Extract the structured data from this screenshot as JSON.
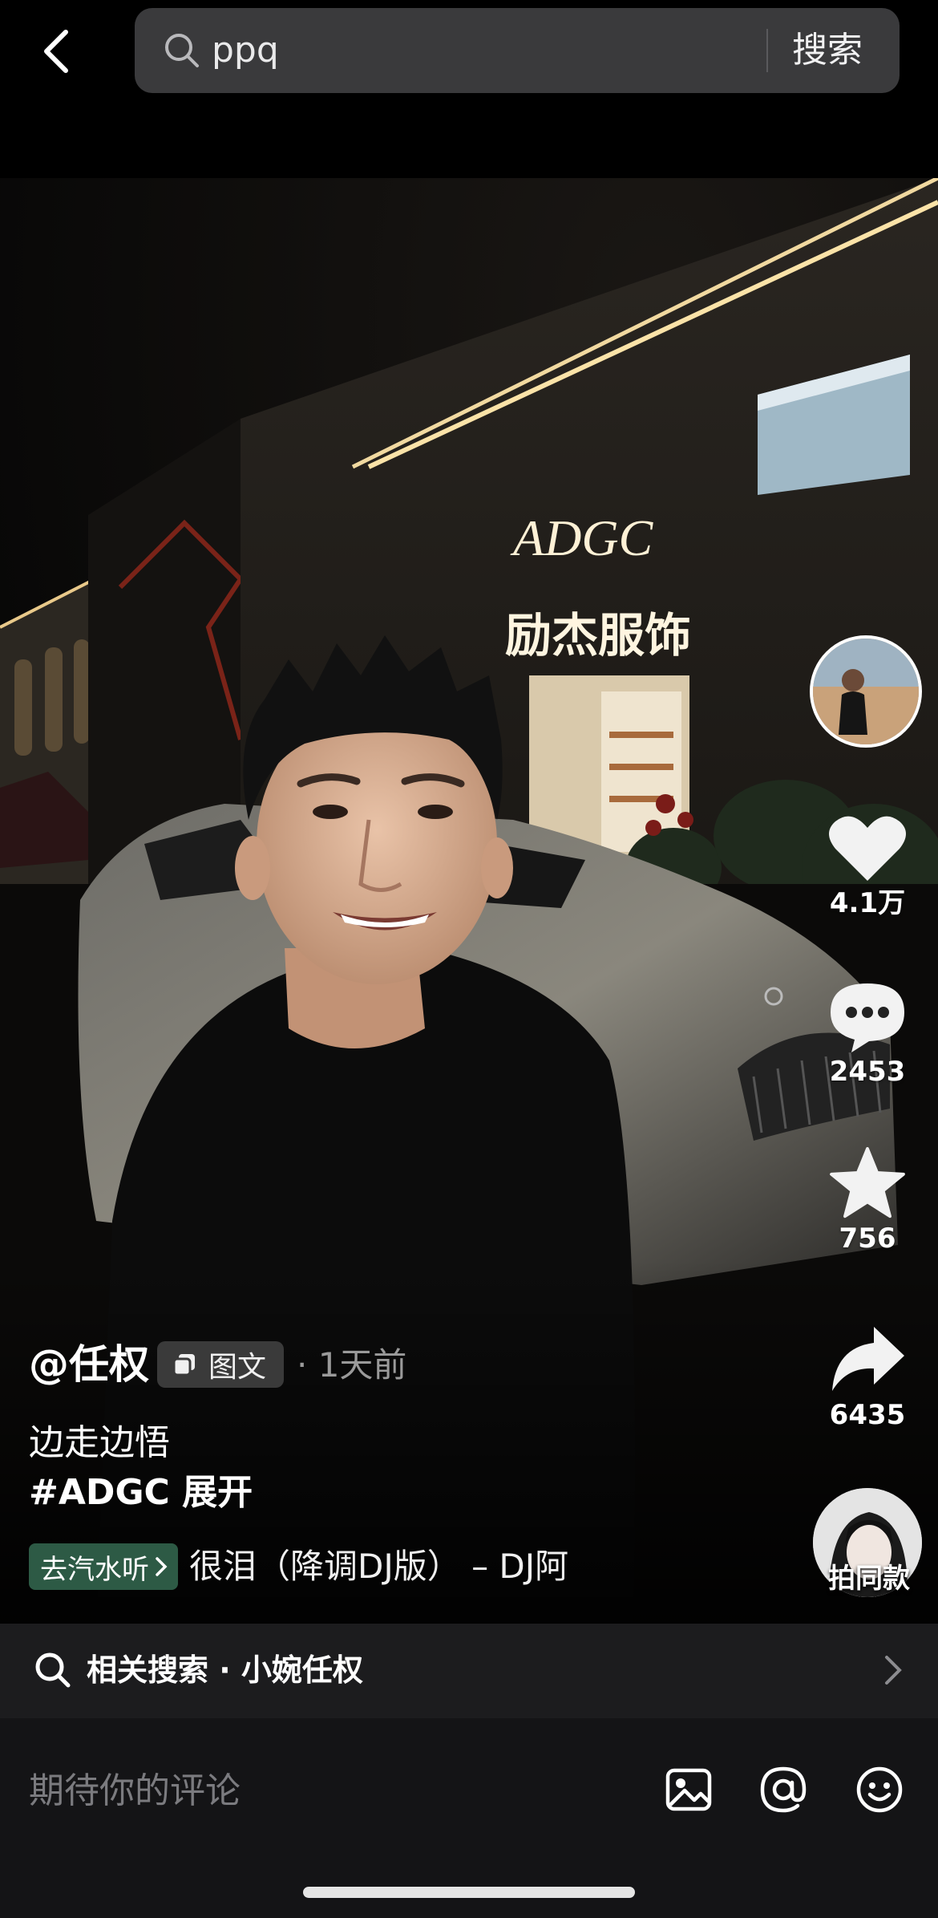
{
  "search": {
    "query": "ppq",
    "button": "搜索"
  },
  "post": {
    "author": "@任权",
    "type_label": "图文",
    "time": "· 1天前",
    "description": "边走边悟",
    "hashtags": "#ADGC  展开",
    "music_button": "去汽水听",
    "music_title": "很泪（降调DJ版） – DJ阿"
  },
  "stats": {
    "likes": "4.1万",
    "comments": "2453",
    "favorites": "756",
    "shares": "6435"
  },
  "same_style": "拍同款",
  "related_search": "相关搜索 · 小婉任权",
  "comment_bar": {
    "placeholder": "期待你的评论"
  },
  "photo_signs": {
    "brand": "ADGC",
    "shop": "励杰服饰"
  },
  "colors": {
    "music_button_bg": "#2d5a45",
    "search_bg": "#3a3a3c",
    "related_bg": "#1c1c1e"
  },
  "icons": [
    "back-arrow-icon",
    "search-icon",
    "heart-icon",
    "comment-bubble-icon",
    "star-icon",
    "share-arrow-icon",
    "image-icon",
    "at-icon",
    "emoji-icon",
    "chevron-right-icon",
    "gallery-icon"
  ]
}
